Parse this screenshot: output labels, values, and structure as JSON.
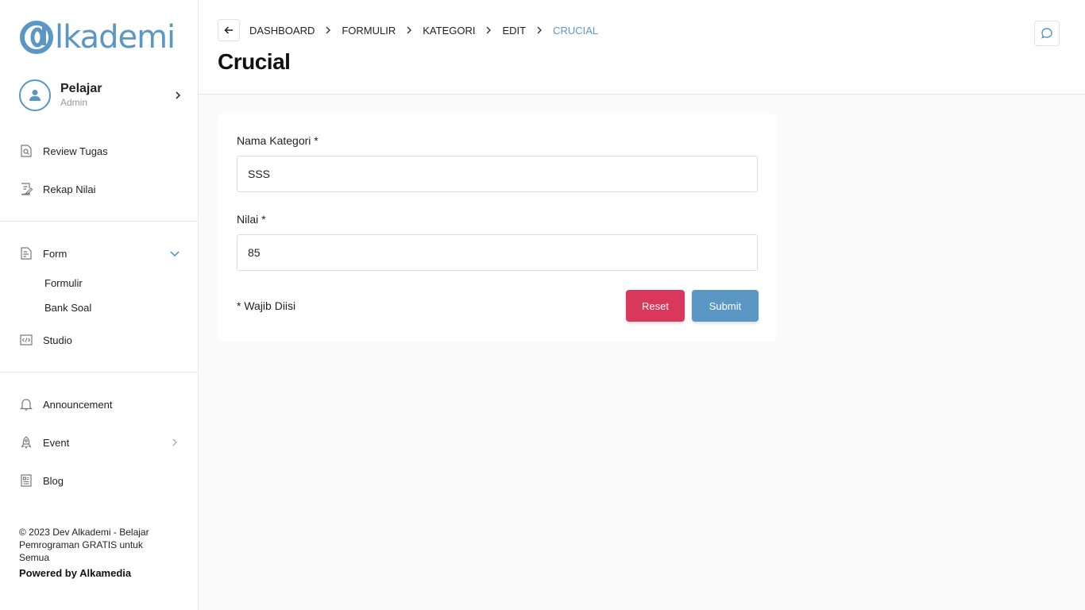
{
  "brand": {
    "logo_text": "lkademi",
    "accent": "#5b97c4",
    "danger": "#d9375c"
  },
  "profile": {
    "name": "Pelajar",
    "role": "Admin"
  },
  "sidebar": {
    "items_top": [
      {
        "label": "Review Tugas",
        "icon": "review-icon"
      },
      {
        "label": "Rekap Nilai",
        "icon": "edit-note-icon"
      }
    ],
    "form": {
      "label": "Form",
      "icon": "form-icon",
      "children": [
        "Formulir",
        "Bank Soal"
      ]
    },
    "studio": {
      "label": "Studio",
      "icon": "code-icon"
    },
    "items_bottom": [
      {
        "label": "Announcement",
        "icon": "bell-icon"
      },
      {
        "label": "Event",
        "icon": "rocket-icon"
      },
      {
        "label": "Blog",
        "icon": "blog-icon"
      }
    ],
    "footer": {
      "copyright": "© 2023 Dev Alkademi - Belajar Pemrograman GRATIS untuk Semua",
      "powered": "Powered by Alkamedia"
    }
  },
  "header": {
    "breadcrumb": [
      "DASHBOARD",
      "FORMULIR",
      "KATEGORI",
      "EDIT",
      "CRUCIAL"
    ],
    "title": "Crucial"
  },
  "form": {
    "category_label": "Nama Kategori *",
    "category_value": "SSS",
    "score_label": "Nilai *",
    "score_value": "85",
    "required_note": "* Wajib Diisi",
    "reset_label": "Reset",
    "submit_label": "Submit"
  }
}
